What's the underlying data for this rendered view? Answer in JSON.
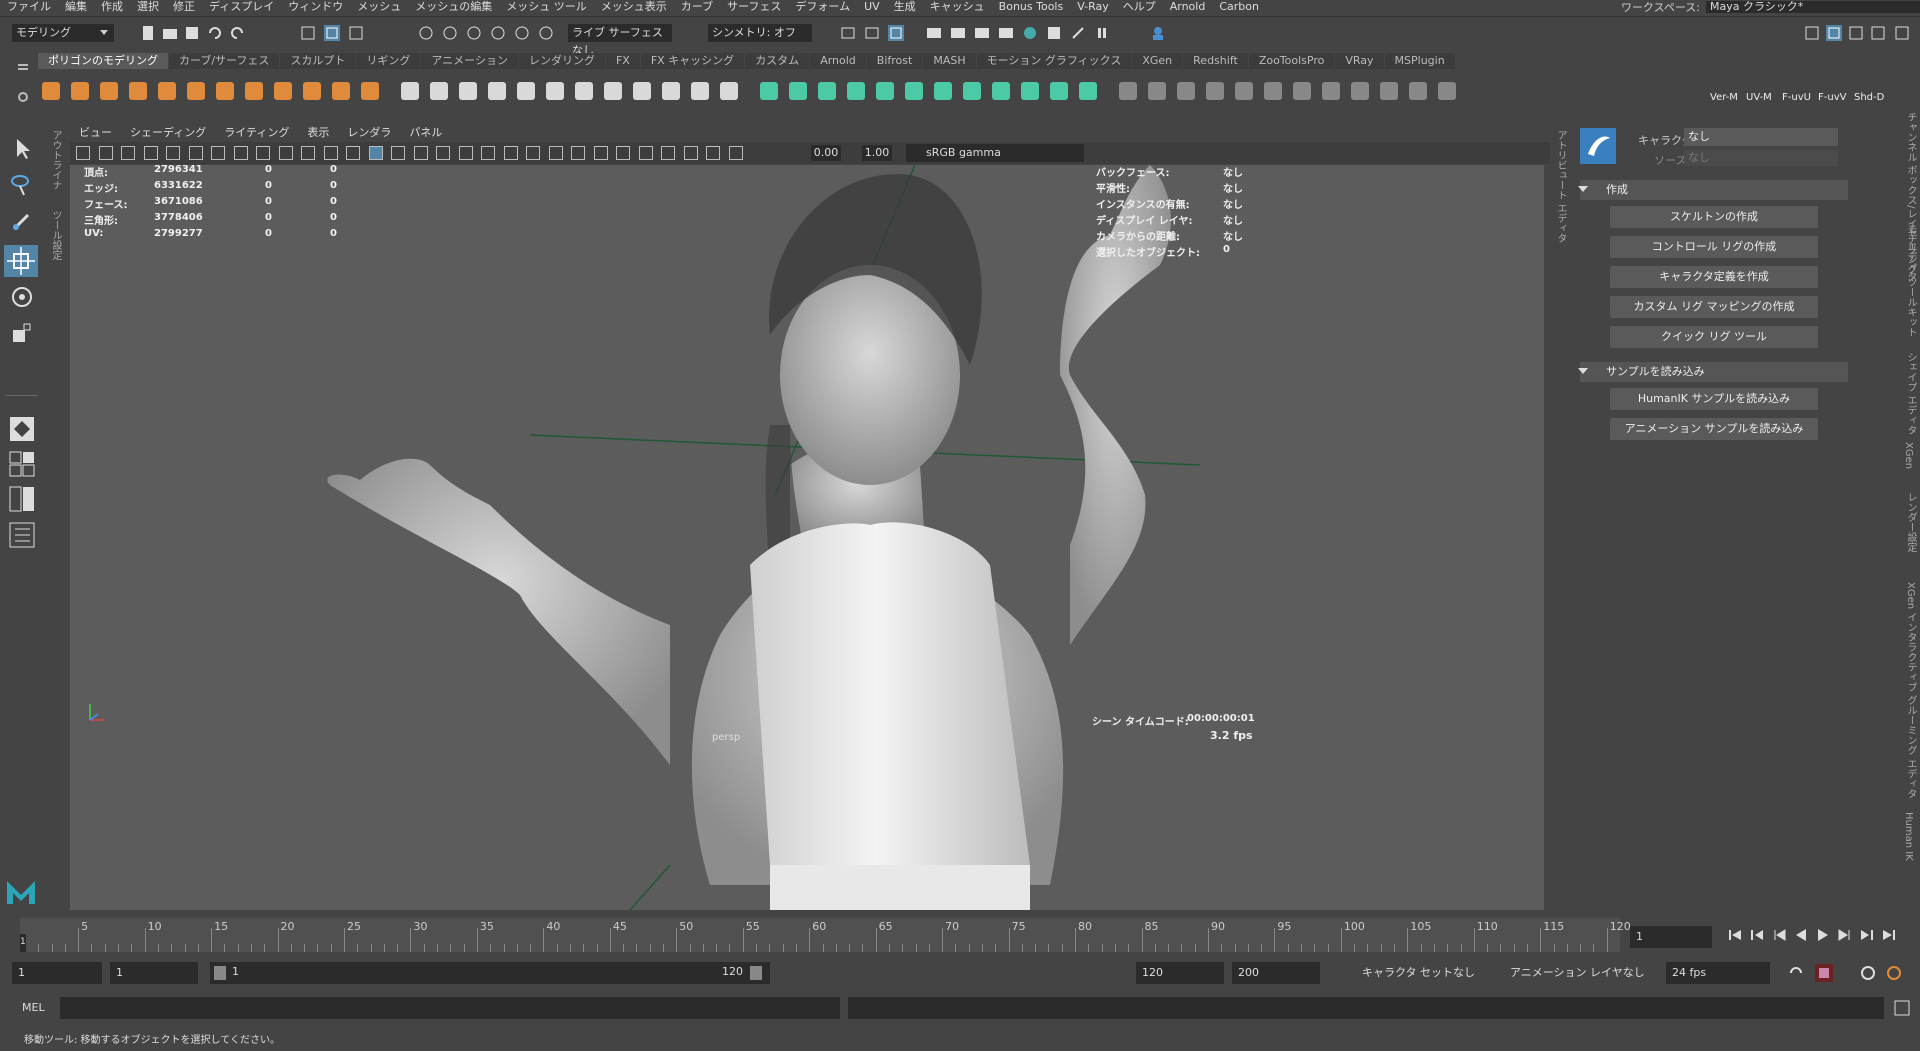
{
  "menubar": [
    "ファイル",
    "編集",
    "作成",
    "選択",
    "修正",
    "ディスプレイ",
    "ウィンドウ",
    "メッシュ",
    "メッシュの編集",
    "メッシュ ツール",
    "メッシュ表示",
    "カーブ",
    "サーフェス",
    "デフォーム",
    "UV",
    "生成",
    "キャッシュ",
    "Bonus Tools",
    "V-Ray",
    "ヘルプ",
    "Arnold",
    "Carbon"
  ],
  "workspace": {
    "label": "ワークスペース:",
    "value": "Maya クラシック*"
  },
  "statusline": {
    "mode": "モデリング",
    "live_surface": "ライブ サーフェスなし",
    "symmetry": "シンメトリ: オフ"
  },
  "shelf_tabs": [
    "ポリゴンのモデリング",
    "カーブ/サーフェス",
    "スカルプト",
    "リギング",
    "アニメーション",
    "レンダリング",
    "FX",
    "FX キャッシング",
    "カスタム",
    "Arnold",
    "Bifrost",
    "MASH",
    "モーション グラフィックス",
    "XGen",
    "Redshift",
    "ZooToolsPro",
    "VRay",
    "MSPlugin"
  ],
  "shelf_right_labels": [
    "Ver-M",
    "UV-M",
    "F-uvU",
    "F-uvV",
    "Shd-D"
  ],
  "left_vtabs": [
    "アウトライナ",
    "ツール設定"
  ],
  "viewport_menu": [
    "ビュー",
    "シェーディング",
    "ライティング",
    "表示",
    "レンダラ",
    "パネル"
  ],
  "viewport_toolbar": {
    "exposure": "0.00",
    "gamma": "1.00",
    "color_space": "sRGB gamma"
  },
  "hud_left": [
    {
      "label": "頂点:",
      "a": "2796341",
      "b": "0",
      "c": "0"
    },
    {
      "label": "エッジ:",
      "a": "6331622",
      "b": "0",
      "c": "0"
    },
    {
      "label": "フェース:",
      "a": "3671086",
      "b": "0",
      "c": "0"
    },
    {
      "label": "三角形:",
      "a": "3778406",
      "b": "0",
      "c": "0"
    },
    {
      "label": "UV:",
      "a": "2799277",
      "b": "0",
      "c": "0"
    }
  ],
  "hud_right": [
    {
      "label": "バックフェース:",
      "value": "なし"
    },
    {
      "label": "平滑性:",
      "value": "なし"
    },
    {
      "label": "インスタンスの有無:",
      "value": "なし"
    },
    {
      "label": "ディスプレイ レイヤ:",
      "value": "なし"
    },
    {
      "label": "カメラからの距離:",
      "value": "なし"
    },
    {
      "label": "選択したオブジェクト:",
      "value": "0"
    }
  ],
  "hud_bottom": {
    "timecode_label": "シーン タイムコード:",
    "timecode": "00:00:00:01",
    "fps": "3.2 fps",
    "camera": "persp"
  },
  "right_vtab": "アトリビュート エディタ",
  "far_right_vtabs": [
    "チャンネル ボックス/レイヤ エディタ",
    "モデリング ツールキット",
    "シェイプ エディタ",
    "XGen",
    "レンダー設定",
    "XGen インタラクティブ グルーミング エディタ",
    "Human IK"
  ],
  "humanik": {
    "character_label": "キャラクタ:",
    "character_value": "なし",
    "source_label": "ソース:",
    "source_value": "なし",
    "section_create": "作成",
    "buttons_create": [
      "スケルトンの作成",
      "コントロール リグの作成",
      "キャラクタ定義を作成",
      "カスタム リグ マッピングの作成",
      "クイック リグ ツール"
    ],
    "section_samples": "サンプルを読み込み",
    "buttons_samples": [
      "HumanIK サンプルを読み込み",
      "アニメーション サンプルを読み込み"
    ]
  },
  "timeline": {
    "ticks": [
      "5",
      "10",
      "15",
      "20",
      "25",
      "30",
      "35",
      "40",
      "45",
      "50",
      "55",
      "60",
      "65",
      "70",
      "75",
      "80",
      "85",
      "90",
      "95",
      "100",
      "105",
      "110",
      "115",
      "120"
    ],
    "current_frame": "1",
    "current_field": "1"
  },
  "range": {
    "start": "1",
    "start2": "1",
    "slider_start": "1",
    "slider_end": "120",
    "end": "120",
    "end2": "200",
    "char_set": "キャラクタ セットなし",
    "anim_layer": "アニメーション レイヤなし",
    "fps": "24 fps"
  },
  "command": {
    "lang": "MEL"
  },
  "helpline": "移動ツール: 移動するオブジェクトを選択してください。"
}
